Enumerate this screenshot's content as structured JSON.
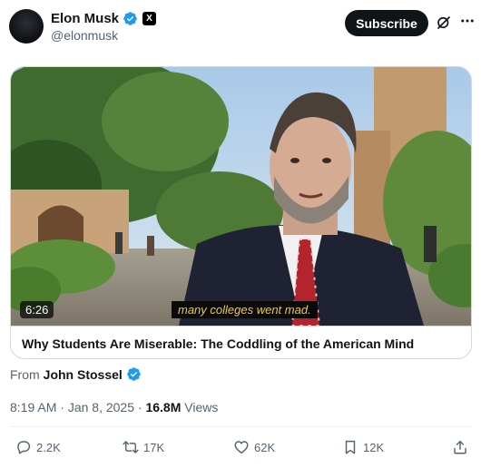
{
  "author": {
    "name": "Elon Musk",
    "handle": "@elonmusk",
    "affiliate_badge": "X"
  },
  "header": {
    "subscribe_label": "Subscribe"
  },
  "card": {
    "duration": "6:26",
    "caption": "many colleges went mad.",
    "title": "Why Students Are Miserable: The Coddling of the American Mind"
  },
  "source": {
    "prefix": "From",
    "name": "John Stossel"
  },
  "meta": {
    "time": "8:19 AM",
    "date": "Jan 8, 2025",
    "views_count": "16.8M",
    "views_label": "Views",
    "separator": "·"
  },
  "actions": {
    "replies": "2.2K",
    "reposts": "17K",
    "likes": "62K",
    "bookmarks": "12K"
  },
  "colors": {
    "verified": "#1d9bf0",
    "text_primary": "#0f1419",
    "text_secondary": "#536471",
    "border": "#cfd9de",
    "caption_text": "#f3c93b"
  },
  "icons": {
    "verified": "verified-badge-icon",
    "grok": "grok-icon",
    "more": "more-icon",
    "reply": "reply-icon",
    "repost": "repost-icon",
    "like": "heart-icon",
    "bookmark": "bookmark-icon",
    "share": "share-icon"
  }
}
